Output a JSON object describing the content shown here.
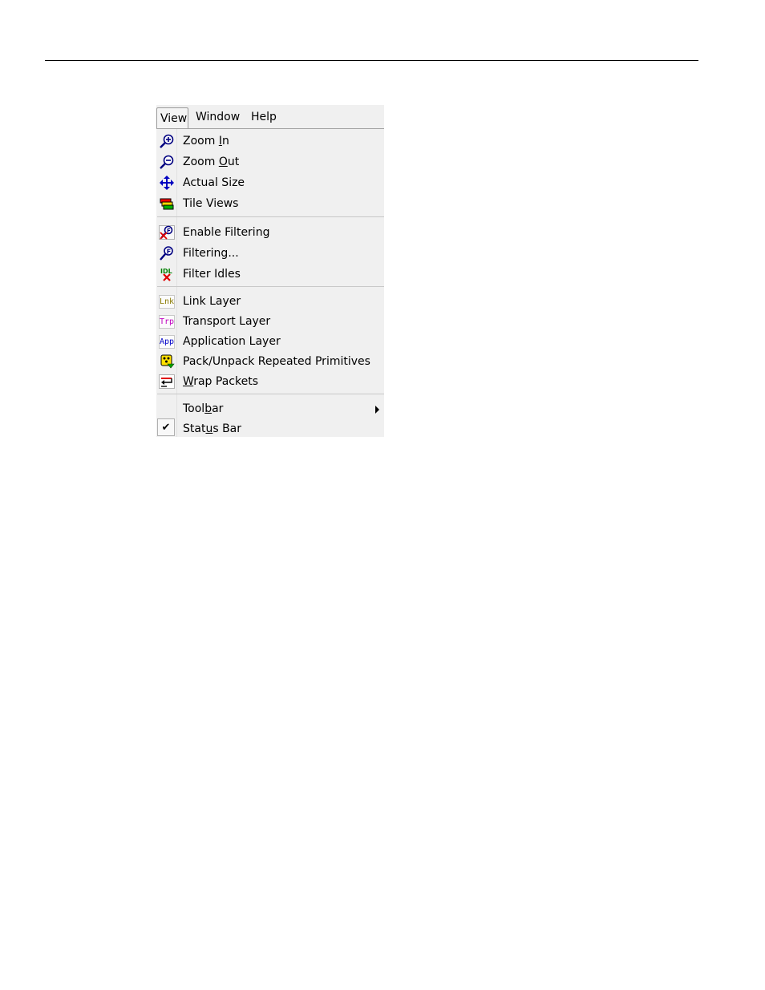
{
  "menubar": {
    "items": [
      {
        "label": "View"
      },
      {
        "label": "Window"
      },
      {
        "label": "Help"
      }
    ]
  },
  "view_menu": {
    "zoom_in": {
      "pre": "Zoom ",
      "acc": "I",
      "post": "n",
      "icon": "zoom-in-icon"
    },
    "zoom_out": {
      "pre": "Zoom ",
      "acc": "O",
      "post": "ut",
      "icon": "zoom-out-icon"
    },
    "actual_size": {
      "label": "Actual Size",
      "icon": "move-arrows-icon"
    },
    "tile_views": {
      "label": "Tile Views",
      "icon": "tile-icon"
    },
    "enable_filtering": {
      "label": "Enable Filtering",
      "icon": "filter-enable-icon"
    },
    "filtering": {
      "label": "Filtering...",
      "icon": "filter-icon"
    },
    "filter_idles": {
      "label": "Filter Idles",
      "icon": "filter-idles-icon",
      "badge": "IDL"
    },
    "link_layer": {
      "label": "Link Layer",
      "badge": "Lnk",
      "badge_color": "#8a7a00"
    },
    "transport_layer": {
      "label": "Transport Layer",
      "badge": "Trp",
      "badge_color": "#c000c0"
    },
    "application_layer": {
      "label": "Application Layer",
      "badge": "App",
      "badge_color": "#0000c8"
    },
    "pack_unpack": {
      "label": "Pack/Unpack Repeated Primitives",
      "icon": "pack-icon"
    },
    "wrap_packets": {
      "acc": "W",
      "post": "rap Packets",
      "icon": "wrap-icon"
    },
    "toolbar": {
      "pre": "Tool",
      "acc": "b",
      "post": "ar",
      "has_submenu": true
    },
    "status_bar": {
      "pre": "Stat",
      "acc": "u",
      "post": "s Bar",
      "checked": true
    }
  }
}
